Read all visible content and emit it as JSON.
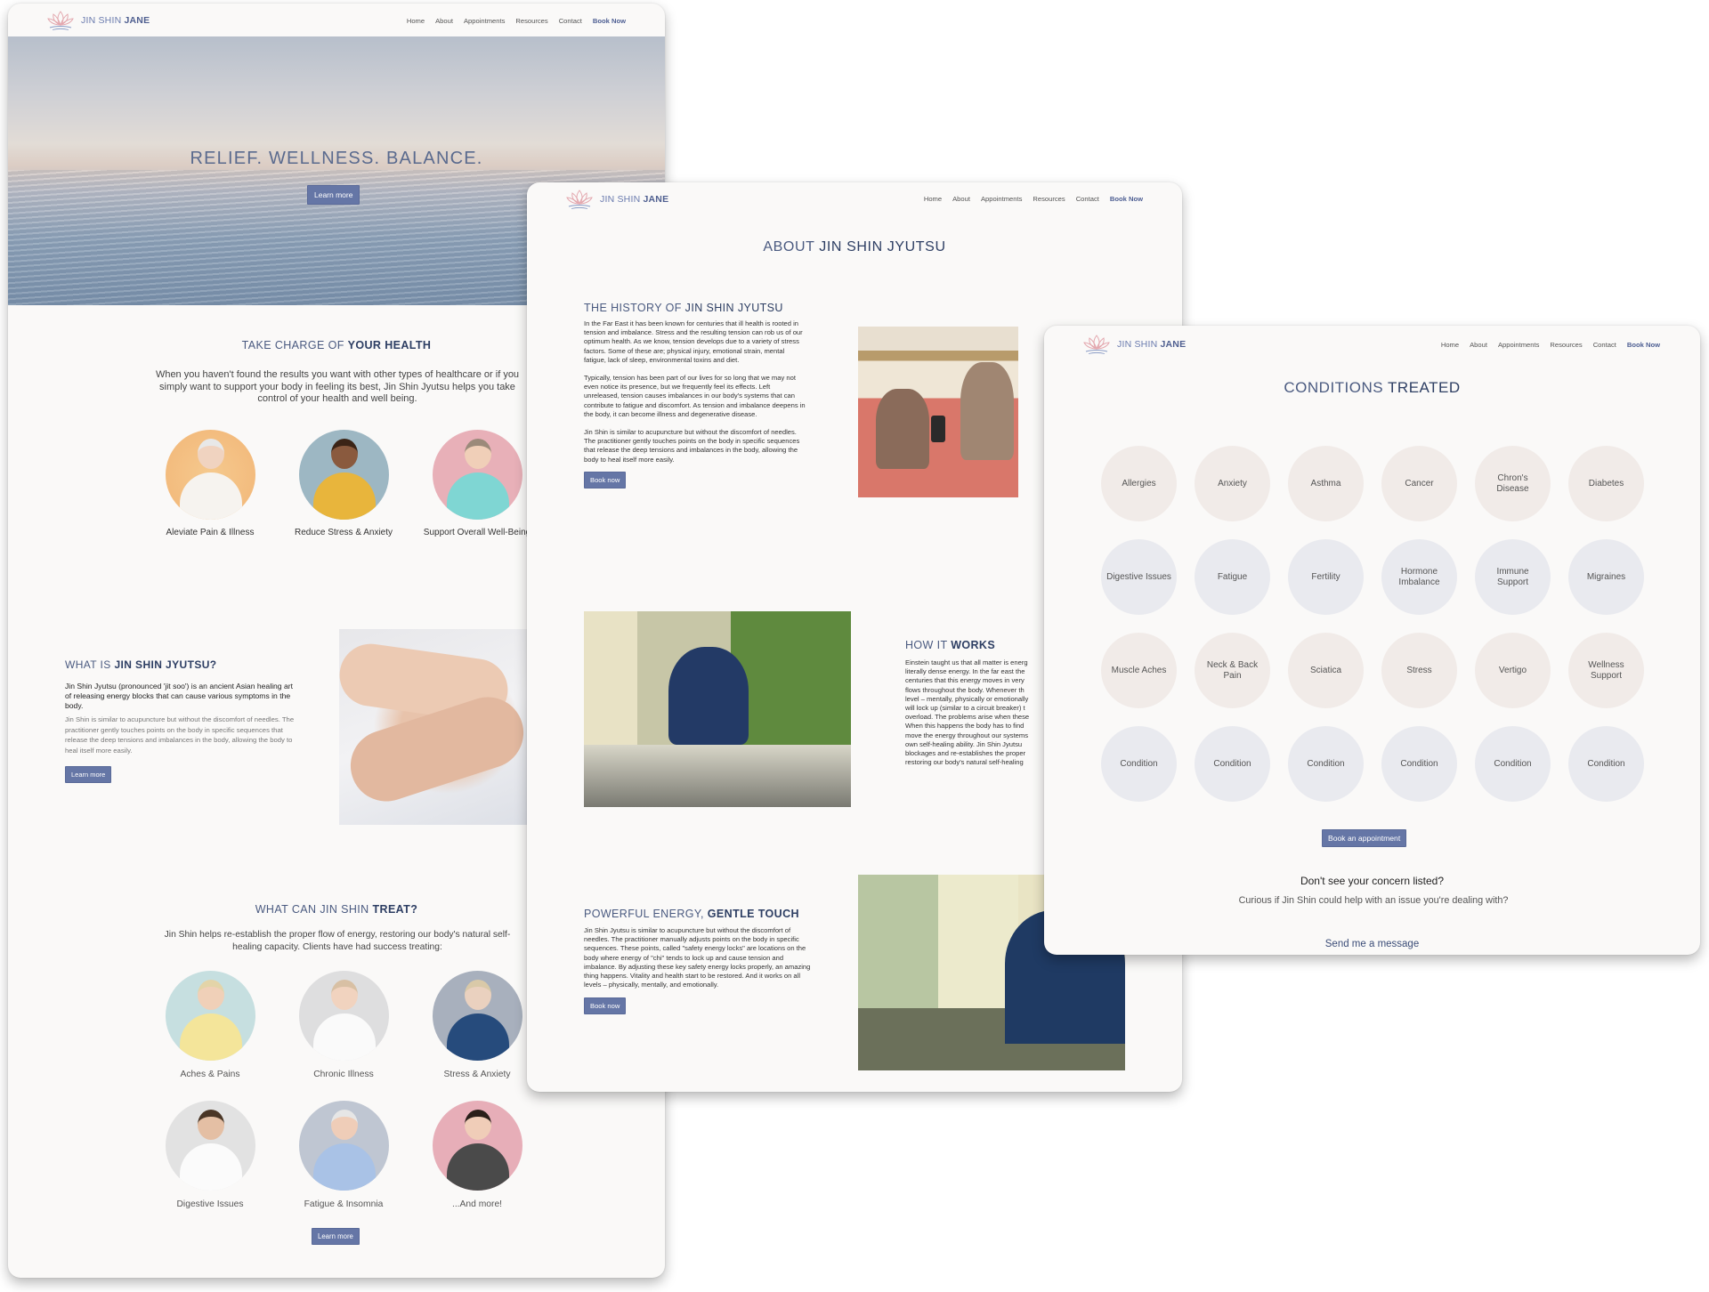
{
  "brand": {
    "logo_light": "JIN SHIN ",
    "logo_bold": "JANE"
  },
  "nav": {
    "items": [
      "Home",
      "About",
      "Appointments",
      "Resources",
      "Contact"
    ],
    "cta": "Book Now"
  },
  "colors": {
    "accent": "#6576a6",
    "heading": "#2d3e63",
    "page_bg": "#faf9f8",
    "logo_pink": "#e3a7ae"
  },
  "home": {
    "hero": {
      "headline": "RELIEF. WELLNESS. BALANCE.",
      "button": "Learn more"
    },
    "take_charge": {
      "title_light": "TAKE CHARGE OF ",
      "title_bold": "YOUR HEALTH",
      "body": "When you haven't found the results you want with other types of healthcare or if you simply want to support your body in feeling its best, Jin Shin Jyutsu helps you take control of your health and well being.",
      "benefits": [
        {
          "label": "Aleviate Pain & Illness"
        },
        {
          "label": "Reduce Stress & Anxiety"
        },
        {
          "label": "Support Overall Well-Being"
        }
      ]
    },
    "what_is": {
      "title_light": "WHAT IS ",
      "title_bold": "JIN SHIN JYUTSU?",
      "lead": "Jin Shin Jyutsu (pronounced 'jit soo') is an ancient Asian healing art of releasing energy blocks that can cause various symptoms in the body.",
      "body": "Jin Shin is similar to acupuncture but without the discomfort of needles. The practitioner gently touches points on the body in specific sequences that release the deep tensions and imbalances in the body, allowing the body to heal itself more easily.",
      "button": "Learn more"
    },
    "treat": {
      "title_light": "WHAT CAN JIN SHIN ",
      "title_bold": "TREAT?",
      "body": "Jin Shin helps re-establish the proper flow of energy, restoring our body's natural self-healing capacity. Clients have had success treating:",
      "items": [
        {
          "label": "Aches & Pains"
        },
        {
          "label": "Chronic Illness"
        },
        {
          "label": "Stress & Anxiety"
        },
        {
          "label": "Digestive Issues"
        },
        {
          "label": "Fatigue & Insomnia"
        },
        {
          "label": "...And more!"
        }
      ],
      "button": "Learn more"
    }
  },
  "about": {
    "title_light": "ABOUT ",
    "title_bold": "JIN SHIN JYUTSU",
    "history": {
      "title_light": "THE HISTORY OF ",
      "title_bold": "JIN SHIN JYUTSU",
      "paragraphs": [
        "In the Far East it has been known for centuries that ill health is rooted in tension and imbalance. Stress and the resulting tension can rob us of our optimum health. As we know, tension develops due to a variety of stress factors. Some of these are; physical injury, emotional strain, mental fatigue, lack of sleep, environmental toxins and diet.",
        "Typically, tension has been part of our lives for so long that we may not even notice its presence, but we frequently feel its effects. Left unreleased, tension causes imbalances in our body's systems that can contribute to fatigue and discomfort. As tension and imbalance deepens in the body, it can become illness and degenerative disease.",
        "Jin Shin is similar to acupuncture but without the discomfort of needles. The practitioner gently touches points on the body in specific sequences that release the deep tensions and imbalances in the body, allowing the body to heal itself more easily."
      ],
      "button": "Book now"
    },
    "how": {
      "title_light": "HOW IT ",
      "title_bold": "WORKS",
      "lines": [
        "Einstein taught us that all matter is energ",
        "literally dense energy.  In the far east the",
        "centuries that this energy moves in very",
        "flows throughout the body.  Whenever th",
        "level – mentally, physically or emotionally",
        "will lock up (similar to a circuit breaker) t",
        "overload. The problems arise when these",
        "When this happens the body has to find",
        "move the energy throughout our systems",
        "own self-healing ability.  Jin Shin Jyutsu",
        "blockages and re-establishes the proper",
        "restoring our body's natural self-healing"
      ]
    },
    "power": {
      "title_light": "POWERFUL ENERGY, ",
      "title_bold": "GENTLE TOUCH",
      "body": "Jin Shin Jyutsu is similar to acupuncture but without the discomfort of needles. The practitioner manually adjusts points on the body in specific sequences. These points, called \"safety energy locks\" are locations on the body where energy of \"chi\" tends to lock up and cause tension and imbalance. By adjusting these key safety energy locks properly, an amazing thing happens. Vitality and health start to be restored. And it works on all levels – physically, mentally, and emotionally.",
      "button": "Book now"
    }
  },
  "conditions": {
    "title_light": "CONDITIONS ",
    "title_bold": "TREATED",
    "items": [
      "Allergies",
      "Anxiety",
      "Asthma",
      "Cancer",
      "Chron's Disease",
      "Diabetes",
      "Digestive Issues",
      "Fatigue",
      "Fertility",
      "Hormone Imbalance",
      "Immune Support",
      "Migraines",
      "Muscle Aches",
      "Neck & Back Pain",
      "Sciatica",
      "Stress",
      "Vertigo",
      "Wellness Support",
      "Condition",
      "Condition",
      "Condition",
      "Condition",
      "Condition",
      "Condition"
    ],
    "button": "Book an appointment",
    "question": "Don't see your concern listed?",
    "sub": "Curious if Jin Shin could help with an issue you're dealing with?",
    "link": "Send me a message"
  }
}
